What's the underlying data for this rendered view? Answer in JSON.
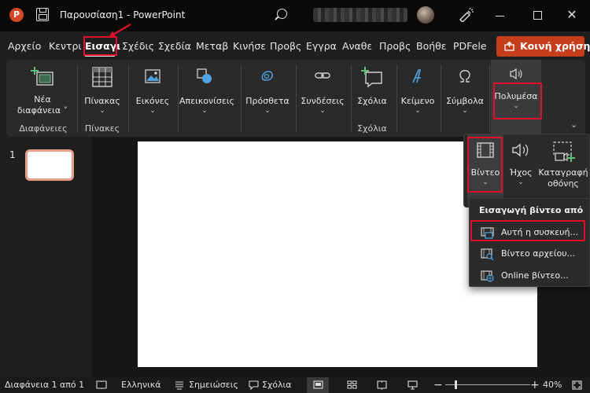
{
  "window": {
    "doc_title": "Παρουσίαση1  -  PowerPoint",
    "app_logo_letter": "P",
    "close_glyph": "✕"
  },
  "tabs": [
    {
      "label": "Αρχείο"
    },
    {
      "label": "Κεντρι"
    },
    {
      "label": "Εισαγι"
    },
    {
      "label": "Σχέδις"
    },
    {
      "label": "Σχεδία"
    },
    {
      "label": "Μεταβ"
    },
    {
      "label": "Κινήσε"
    },
    {
      "label": "Προβς"
    },
    {
      "label": "Εγγρα"
    },
    {
      "label": "Αναθε"
    },
    {
      "label": "Προβς"
    },
    {
      "label": "Βοήθε"
    },
    {
      "label": "PDFele"
    }
  ],
  "share_button": {
    "label": "Κοινή χρήση"
  },
  "ribbon": {
    "new_slide": {
      "label_line1": "Νέα",
      "label_line2": "διαφάνεια ˅",
      "group_label": "Διαφάνειες"
    },
    "table": {
      "label": "Πίνακας",
      "group_label": "Πίνακες"
    },
    "images": {
      "label": "Εικόνες"
    },
    "shapes": {
      "label": "Απεικονίσεις"
    },
    "addins": {
      "label": "Πρόσθετα"
    },
    "links": {
      "label": "Συνδέσεις"
    },
    "comments": {
      "label": "Σχόλια",
      "group_label": "Σχόλια"
    },
    "text": {
      "label": "Κείμενο"
    },
    "symbols": {
      "label": "Σύμβολα"
    },
    "media": {
      "label": "Πολυμέσα"
    },
    "dropdown_glyph": "⌄",
    "collapse_glyph": "⌄"
  },
  "slides": {
    "current_number": "1"
  },
  "media_submenu": {
    "video": {
      "label": "Βίντεο"
    },
    "audio": {
      "label": "Ήχος"
    },
    "screen_recording": {
      "label_line1": "Καταγραφή",
      "label_line2": "οθόνης"
    }
  },
  "video_dropdown": {
    "header": "Εισαγωγή βίντεο από",
    "items": [
      {
        "label": "Αυτή η συσκευή..."
      },
      {
        "label": "Βίντεο αρχείου..."
      },
      {
        "label": "Online βίντεο..."
      }
    ]
  },
  "status_bar": {
    "slide_counter": "Διαφάνεια 1 από 1",
    "language": "Ελληνικά",
    "notes": "Σημειώσεις",
    "comments": "Σχόλια",
    "zoom": "40%"
  },
  "colors": {
    "accent_red_highlight": "#e0102a",
    "share_button": "#c43e1c",
    "powerpoint_logo": "#d24726",
    "thumbnail_border": "#e8a08a"
  }
}
